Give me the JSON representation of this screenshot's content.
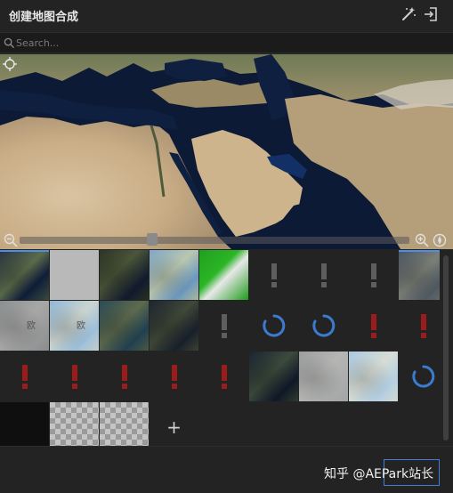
{
  "header": {
    "title": "创建地图合成",
    "magic_icon": "magic-wand-icon",
    "import_icon": "import-icon"
  },
  "search": {
    "placeholder": "Search...",
    "value": ""
  },
  "map": {
    "locate_icon": "crosshair-icon",
    "zoom_out_icon": "zoom-out-icon",
    "zoom_in_icon": "zoom-in-icon",
    "compass_icon": "compass-icon",
    "zoom_level": 0.34
  },
  "tiles": [
    {
      "kind": "map",
      "style": "satellite"
    },
    {
      "kind": "plain",
      "style": "gray"
    },
    {
      "kind": "map",
      "style": "satellite-dark"
    },
    {
      "kind": "map",
      "style": "terrain-blue"
    },
    {
      "kind": "map",
      "style": "green"
    },
    {
      "kind": "icon",
      "icon": "exclamation-gray"
    },
    {
      "kind": "icon",
      "icon": "exclamation-gray"
    },
    {
      "kind": "icon",
      "icon": "exclamation-gray"
    },
    {
      "kind": "map",
      "style": "slate"
    },
    {
      "kind": "map",
      "style": "gray-labels",
      "label": "欧"
    },
    {
      "kind": "map",
      "style": "light-blue",
      "label": "欧"
    },
    {
      "kind": "map",
      "style": "teal-dark"
    },
    {
      "kind": "map",
      "style": "dark-navy"
    },
    {
      "kind": "icon",
      "icon": "exclamation-gray"
    },
    {
      "kind": "icon",
      "icon": "loading-spinner"
    },
    {
      "kind": "icon",
      "icon": "loading-spinner"
    },
    {
      "kind": "icon",
      "icon": "exclamation-red"
    },
    {
      "kind": "icon",
      "icon": "exclamation-red"
    },
    {
      "kind": "icon",
      "icon": "exclamation-red"
    },
    {
      "kind": "icon",
      "icon": "exclamation-red"
    },
    {
      "kind": "icon",
      "icon": "exclamation-red"
    },
    {
      "kind": "icon",
      "icon": "exclamation-red"
    },
    {
      "kind": "icon",
      "icon": "exclamation-red"
    },
    {
      "kind": "map",
      "style": "satellite-night"
    },
    {
      "kind": "map",
      "style": "light-gray"
    },
    {
      "kind": "map",
      "style": "pale-blue"
    },
    {
      "kind": "icon",
      "icon": "loading-spinner"
    },
    {
      "kind": "plain",
      "style": "black"
    },
    {
      "kind": "plain",
      "style": "checker"
    },
    {
      "kind": "plain",
      "style": "checker"
    },
    {
      "kind": "icon",
      "icon": "plus-icon",
      "label": "+"
    }
  ],
  "footer": {
    "watermark": "知乎 @AEPark站长"
  },
  "colors": {
    "accent": "#3d7fd9",
    "error": "#9c1c1c",
    "spinner": "#3b7bd0",
    "warning_gray": "#5e5e5e"
  }
}
